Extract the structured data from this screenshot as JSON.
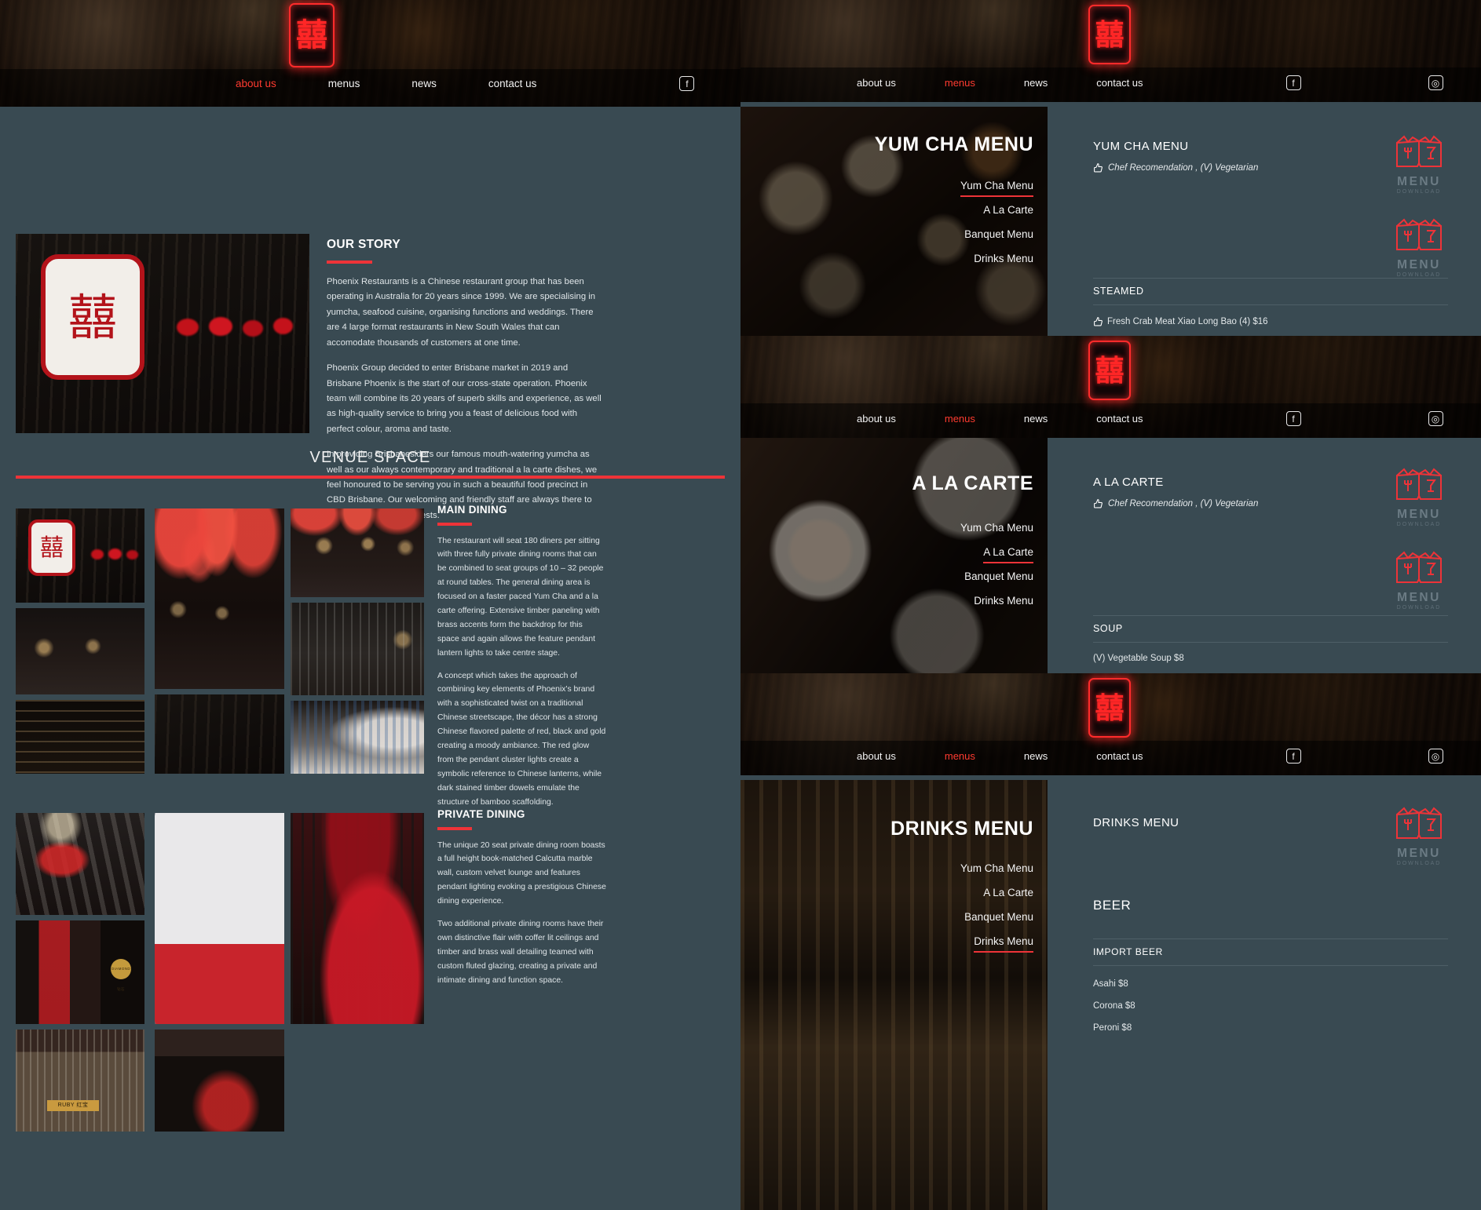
{
  "brand": {
    "logo_glyph": "囍",
    "logo_name": "phoenix-neon-logo"
  },
  "nav": {
    "items": [
      "about us",
      "menus",
      "news",
      "contact us"
    ],
    "social": [
      "facebook-icon",
      "instagram-icon"
    ]
  },
  "left_page": {
    "active_nav": "about us",
    "story": {
      "heading": "OUR STORY",
      "paragraphs": [
        "Phoenix Restaurants is a Chinese restaurant group that has been operating in Australia for 20 years since 1999. We are specialising in yumcha, seafood cuisine, organising functions and weddings. There are 4 large format restaurants in New South Wales that can accomodate thousands of customers at one time.",
        "Phoenix Group decided to enter Brisbane market in 2019 and Brisbane Phoenix is the start of our cross-state operation. Phoenix team will combine its 20 years of superb skills and experience, as well as high-quality service to bring you a feast of delicious food with perfect colour, aroma and taste.",
        "In providing Brisbanesiders our famous mouth-watering yumcha as well as our always contemporary and traditional a la carte dishes, we feel honoured to be serving you in such a beautiful food precinct in CBD Brisbane. Our welcoming and friendly staff are always there to service you and your guests."
      ]
    },
    "venue": {
      "title": "VENUE SPACE"
    },
    "main_dining": {
      "heading": "MAIN DINING",
      "paragraphs": [
        "The restaurant will seat 180 diners per sitting with three fully private dining rooms that can be combined to seat groups of 10 – 32 people at round tables. The general dining area is focused on a faster paced Yum Cha and a la carte offering. Extensive timber paneling with brass accents form the backdrop for this space and again allows the feature pendant lantern lights to take centre stage.",
        "A concept which takes the approach of combining key elements of Phoenix's brand with a sophisticated twist on a traditional Chinese streetscape, the décor has a strong Chinese flavored palette of red, black and gold creating a moody ambiance. The red glow from the pendant cluster lights create a symbolic reference to Chinese lanterns, while dark stained timber dowels emulate the structure of bamboo scaffolding."
      ]
    },
    "private_dining": {
      "heading": "PRIVATE DINING",
      "paragraphs": [
        "The unique 20 seat private dining room boasts a full height book-matched Calcutta marble wall, custom velvet lounge and features pendant lighting evoking a prestigious Chinese dining experience.",
        "Two additional private dining rooms have their own distinctive flair with coffer lit ceilings and timber and brass wall detailing teamed with custom fluted glazing, creating a private and intimate dining and function space."
      ]
    },
    "gallery_labels": [
      "RUBY 红宝",
      "DIAMOND 钻石"
    ]
  },
  "menu_pages": [
    {
      "active_nav": "menus",
      "hero_title": "YUM CHA MENU",
      "hero_nav": [
        "Yum Cha Menu",
        "A La Carte",
        "Banquet Menu",
        "Drinks Menu"
      ],
      "hero_selected": "Yum Cha Menu",
      "panel_title": "YUM CHA MENU",
      "legend": "Chef Recomendation , (V) Vegetarian",
      "downloads": [
        {
          "label_1": "MENU",
          "label_2": "DOWNLOAD"
        },
        {
          "label_1": "MENU",
          "label_2": "DOWNLOAD"
        }
      ],
      "category": "STEAMED",
      "items": [
        {
          "text": "Fresh Crab Meat Xiao Long Bao (4) $16",
          "chef": true
        }
      ]
    },
    {
      "active_nav": "menus",
      "hero_title": "A LA CARTE",
      "hero_nav": [
        "Yum Cha Menu",
        "A La Carte",
        "Banquet Menu",
        "Drinks Menu"
      ],
      "hero_selected": "A La Carte",
      "panel_title": "A LA CARTE",
      "legend": "Chef Recomendation , (V) Vegetarian",
      "downloads": [
        {
          "label_1": "MENU",
          "label_2": "DOWNLOAD"
        },
        {
          "label_1": "MENU",
          "label_2": "DOWNLOAD"
        }
      ],
      "category": "SOUP",
      "items": [
        {
          "text": "(V) Vegetable Soup $8",
          "chef": false
        }
      ]
    },
    {
      "active_nav": "menus",
      "hero_title": "DRINKS MENU",
      "hero_nav": [
        "Yum Cha Menu",
        "A La Carte",
        "Banquet Menu",
        "Drinks Menu"
      ],
      "hero_selected": "Drinks Menu",
      "panel_title": "DRINKS MENU",
      "legend": "",
      "downloads": [
        {
          "label_1": "MENU",
          "label_2": "DOWNLOAD"
        }
      ],
      "big_category": "BEER",
      "category": "IMPORT BEER",
      "items": [
        {
          "text": "Asahi $8",
          "chef": false
        },
        {
          "text": "Corona $8",
          "chef": false
        },
        {
          "text": "Peroni $8",
          "chef": false
        }
      ]
    }
  ],
  "colors": {
    "accent_red": "#ee3338",
    "nav_active": "#ff3b30",
    "panel_bg": "#394a52",
    "page_bg": "#2f3e46"
  }
}
